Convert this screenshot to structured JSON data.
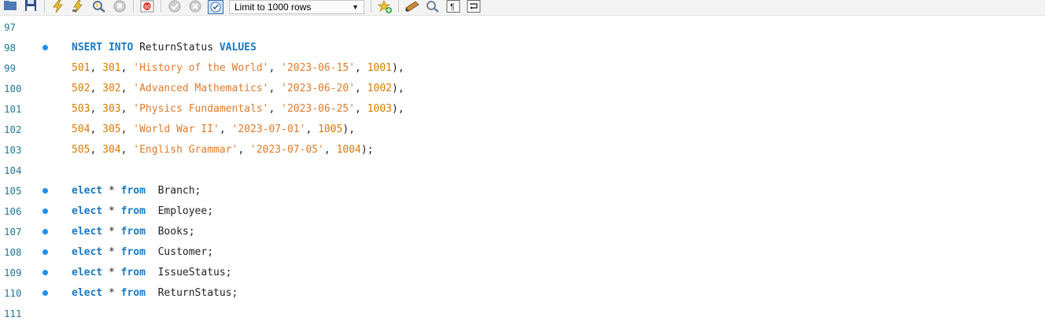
{
  "toolbar": {
    "icons": [
      "folder-icon",
      "save-icon",
      "execute-icon",
      "execute-current-icon",
      "explain-icon",
      "stop-icon",
      "toggle-error-icon",
      "commit-icon",
      "rollback-icon",
      "autocommit-icon"
    ],
    "limit_label": "Limit to 1000 rows",
    "icons_after": [
      "add-snippet-icon",
      "beautify-icon",
      "find-icon",
      "invisible-chars-icon",
      "wrap-icon"
    ]
  },
  "editor": {
    "lines": [
      {
        "num": "97",
        "dot": false,
        "tokens": []
      },
      {
        "num": "98",
        "dot": true,
        "tokens": [
          {
            "t": "NSERT",
            "c": "kw"
          },
          {
            "t": " ",
            "c": "pn"
          },
          {
            "t": "INTO",
            "c": "kw"
          },
          {
            "t": " ReturnStatus ",
            "c": "id"
          },
          {
            "t": "VALUES",
            "c": "kw"
          }
        ]
      },
      {
        "num": "99",
        "dot": false,
        "tokens": [
          {
            "t": "501",
            "c": "num"
          },
          {
            "t": ", ",
            "c": "pn"
          },
          {
            "t": "301",
            "c": "num"
          },
          {
            "t": ", ",
            "c": "pn"
          },
          {
            "t": "'History of the World'",
            "c": "str"
          },
          {
            "t": ", ",
            "c": "pn"
          },
          {
            "t": "'2023-06-15'",
            "c": "str"
          },
          {
            "t": ", ",
            "c": "pn"
          },
          {
            "t": "1001",
            "c": "num"
          },
          {
            "t": "),",
            "c": "pn"
          }
        ]
      },
      {
        "num": "100",
        "dot": false,
        "tokens": [
          {
            "t": "502",
            "c": "num"
          },
          {
            "t": ", ",
            "c": "pn"
          },
          {
            "t": "302",
            "c": "num"
          },
          {
            "t": ", ",
            "c": "pn"
          },
          {
            "t": "'Advanced Mathematics'",
            "c": "str"
          },
          {
            "t": ", ",
            "c": "pn"
          },
          {
            "t": "'2023-06-20'",
            "c": "str"
          },
          {
            "t": ", ",
            "c": "pn"
          },
          {
            "t": "1002",
            "c": "num"
          },
          {
            "t": "),",
            "c": "pn"
          }
        ]
      },
      {
        "num": "101",
        "dot": false,
        "tokens": [
          {
            "t": "503",
            "c": "num"
          },
          {
            "t": ", ",
            "c": "pn"
          },
          {
            "t": "303",
            "c": "num"
          },
          {
            "t": ", ",
            "c": "pn"
          },
          {
            "t": "'Physics Fundamentals'",
            "c": "str"
          },
          {
            "t": ", ",
            "c": "pn"
          },
          {
            "t": "'2023-06-25'",
            "c": "str"
          },
          {
            "t": ", ",
            "c": "pn"
          },
          {
            "t": "1003",
            "c": "num"
          },
          {
            "t": "),",
            "c": "pn"
          }
        ]
      },
      {
        "num": "102",
        "dot": false,
        "tokens": [
          {
            "t": "504",
            "c": "num"
          },
          {
            "t": ", ",
            "c": "pn"
          },
          {
            "t": "305",
            "c": "num"
          },
          {
            "t": ", ",
            "c": "pn"
          },
          {
            "t": "'World War II'",
            "c": "str"
          },
          {
            "t": ", ",
            "c": "pn"
          },
          {
            "t": "'2023-07-01'",
            "c": "str"
          },
          {
            "t": ", ",
            "c": "pn"
          },
          {
            "t": "1005",
            "c": "num"
          },
          {
            "t": "),",
            "c": "pn"
          }
        ]
      },
      {
        "num": "103",
        "dot": false,
        "tokens": [
          {
            "t": "505",
            "c": "num"
          },
          {
            "t": ", ",
            "c": "pn"
          },
          {
            "t": "304",
            "c": "num"
          },
          {
            "t": ", ",
            "c": "pn"
          },
          {
            "t": "'English Grammar'",
            "c": "str"
          },
          {
            "t": ", ",
            "c": "pn"
          },
          {
            "t": "'2023-07-05'",
            "c": "str"
          },
          {
            "t": ", ",
            "c": "pn"
          },
          {
            "t": "1004",
            "c": "num"
          },
          {
            "t": ");",
            "c": "pn"
          }
        ]
      },
      {
        "num": "104",
        "dot": false,
        "tokens": []
      },
      {
        "num": "105",
        "dot": true,
        "tokens": [
          {
            "t": "elect",
            "c": "kw"
          },
          {
            "t": " * ",
            "c": "pn"
          },
          {
            "t": "from",
            "c": "kw"
          },
          {
            "t": "  Branch;",
            "c": "id"
          }
        ]
      },
      {
        "num": "106",
        "dot": true,
        "tokens": [
          {
            "t": "elect",
            "c": "kw"
          },
          {
            "t": " * ",
            "c": "pn"
          },
          {
            "t": "from",
            "c": "kw"
          },
          {
            "t": "  Employee;",
            "c": "id"
          }
        ]
      },
      {
        "num": "107",
        "dot": true,
        "tokens": [
          {
            "t": "elect",
            "c": "kw"
          },
          {
            "t": " * ",
            "c": "pn"
          },
          {
            "t": "from",
            "c": "kw"
          },
          {
            "t": "  Books;",
            "c": "id"
          }
        ]
      },
      {
        "num": "108",
        "dot": true,
        "tokens": [
          {
            "t": "elect",
            "c": "kw"
          },
          {
            "t": " * ",
            "c": "pn"
          },
          {
            "t": "from",
            "c": "kw"
          },
          {
            "t": "  Customer;",
            "c": "id"
          }
        ]
      },
      {
        "num": "109",
        "dot": true,
        "tokens": [
          {
            "t": "elect",
            "c": "kw"
          },
          {
            "t": " * ",
            "c": "pn"
          },
          {
            "t": "from",
            "c": "kw"
          },
          {
            "t": "  IssueStatus;",
            "c": "id"
          }
        ]
      },
      {
        "num": "110",
        "dot": true,
        "tokens": [
          {
            "t": "elect",
            "c": "kw"
          },
          {
            "t": " * ",
            "c": "pn"
          },
          {
            "t": "from",
            "c": "kw"
          },
          {
            "t": "  ReturnStatus;",
            "c": "id"
          }
        ]
      },
      {
        "num": "111",
        "dot": false,
        "tokens": []
      }
    ]
  },
  "colors": {
    "keyword": "#1a78c2",
    "number": "#d97a00",
    "string": "#e07a2a",
    "gutter": "#237893",
    "dot": "#1e8ff0"
  }
}
